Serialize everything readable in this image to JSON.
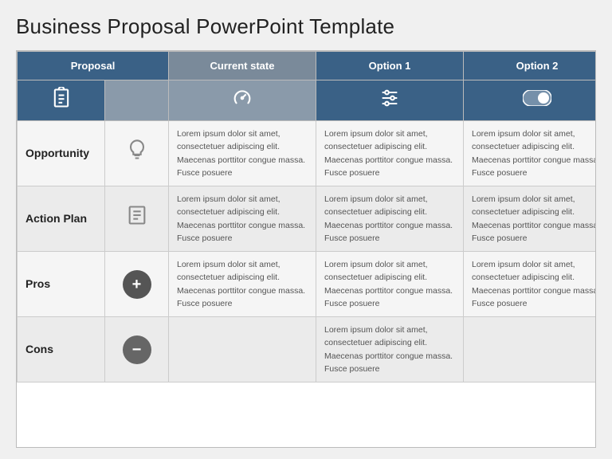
{
  "page": {
    "title": "Business Proposal PowerPoint Template"
  },
  "header": {
    "col_proposal": "Proposal",
    "col_current": "Current state",
    "col_opt1": "Option 1",
    "col_opt2": "Option 2"
  },
  "rows": [
    {
      "label": "Opportunity",
      "text": "Lorem ipsum dolor sit amet, consectetuer adipiscing elit. Maecenas porttitor congue massa. Fusce posuere"
    },
    {
      "label": "Action Plan",
      "text": "Lorem ipsum dolor sit amet, consectetuer adipiscing elit. Maecenas porttitor congue massa. Fusce posuere"
    },
    {
      "label": "Pros",
      "text": "Lorem ipsum dolor sit amet, consectetuer adipiscing elit. Maecenas porttitor congue massa. Fusce posuere"
    },
    {
      "label": "Cons",
      "text": "Lorem ipsum dolor sit amet, consectetuer adipiscing elit. Maecenas porttitor congue massa. Fusce posuere"
    }
  ],
  "lorem": "Lorem ipsum dolor sit amet, consectetuer adipiscing elit. Maecenas porttitor congue massa. Fusce posuere"
}
